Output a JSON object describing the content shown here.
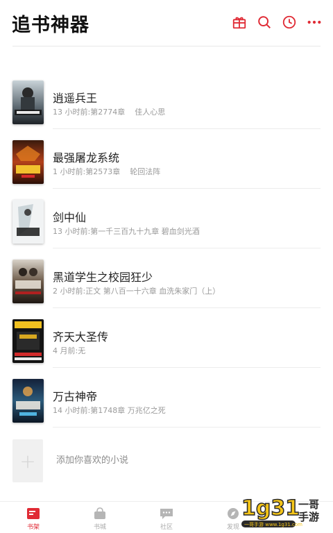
{
  "header": {
    "title": "追书神器",
    "icons": [
      "gift-icon",
      "search-icon",
      "clock-icon",
      "more-icon"
    ],
    "accent_color": "#e02b35"
  },
  "books": [
    {
      "title": "逍遥兵王",
      "time": "13 小时前:",
      "chapter": "第2774章",
      "author": "佳人心思"
    },
    {
      "title": "最强屠龙系统",
      "time": "1 小时前:",
      "chapter": "第2573章",
      "author": "轮回法阵"
    },
    {
      "title": "剑中仙",
      "time": "13 小时前:",
      "chapter": "第一千三百九十九章 碧血剑光酒",
      "author": ""
    },
    {
      "title": "黑道学生之校园狂少",
      "time": "2 小时前:",
      "chapter": "正文 第八百一十六章 血洗朱家门（上）",
      "author": ""
    },
    {
      "title": "齐天大圣传",
      "time": "4 月前:",
      "chapter": "无",
      "author": ""
    },
    {
      "title": "万古神帝",
      "time": "14 小时前:",
      "chapter": "第1748章 万兆亿之死",
      "author": ""
    }
  ],
  "add_book": {
    "icon": "+",
    "label": "添加你喜欢的小说"
  },
  "nav": [
    {
      "label": "书架",
      "icon": "bookshelf-icon",
      "active": true
    },
    {
      "label": "书城",
      "icon": "bookstore-icon",
      "active": false
    },
    {
      "label": "社区",
      "icon": "community-icon",
      "active": false
    },
    {
      "label": "发现",
      "icon": "discover-icon",
      "active": false
    }
  ],
  "watermark": {
    "text": "1g31 一哥手游",
    "url_text": "一哥手游 www.1g31.com"
  }
}
